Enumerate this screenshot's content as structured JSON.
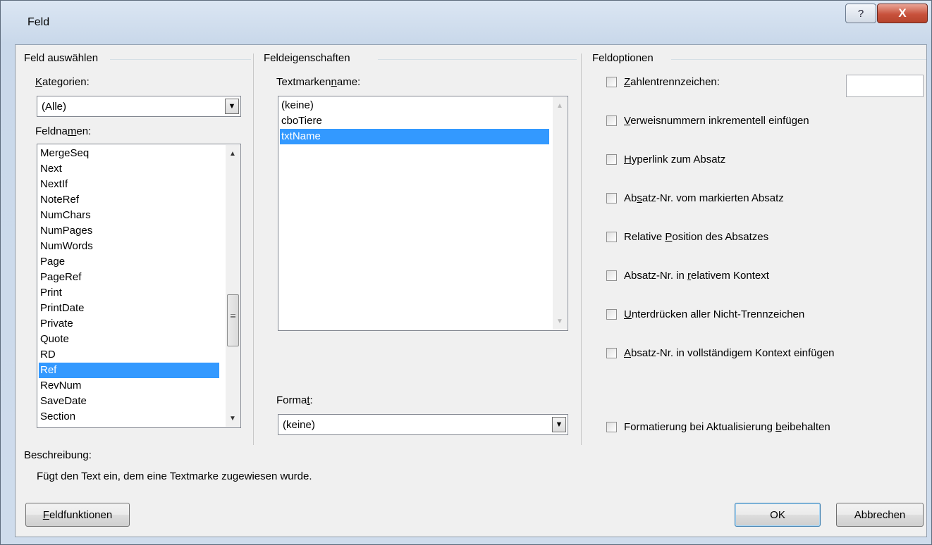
{
  "window": {
    "title": "Feld",
    "help_glyph": "?",
    "close_glyph": "X"
  },
  "select_field": {
    "group_title": "Feld auswählen",
    "categories_label_pre": "",
    "categories_label_mn": "K",
    "categories_label_post": "ategorien:",
    "categories_value": "(Alle)",
    "fieldnames_label_pre": "Feldna",
    "fieldnames_label_mn": "m",
    "fieldnames_label_post": "en:",
    "fieldnames": [
      "MergeSeq",
      "Next",
      "NextIf",
      "NoteRef",
      "NumChars",
      "NumPages",
      "NumWords",
      "Page",
      "PageRef",
      "Print",
      "PrintDate",
      "Private",
      "Quote",
      "RD",
      "Ref",
      "RevNum",
      "SaveDate",
      "Section"
    ],
    "selected_fieldname": "Ref"
  },
  "properties": {
    "group_title": "Feldeigenschaften",
    "bookmark_label_pre": "Textmarken",
    "bookmark_label_mn": "n",
    "bookmark_label_post": "ame:",
    "bookmarks": [
      "(keine)",
      "cboTiere",
      "txtName"
    ],
    "selected_bookmark": "txtName",
    "format_label_pre": "Forma",
    "format_label_mn": "t",
    "format_label_post": ":",
    "format_value": "(keine)"
  },
  "options": {
    "group_title": "Feldoptionen",
    "items": [
      {
        "pre": "",
        "mn": "Z",
        "post": "ahlentrennzeichen:",
        "checked": false
      },
      {
        "pre": "",
        "mn": "V",
        "post": "erweisnummern inkrementell einfügen",
        "checked": false
      },
      {
        "pre": "",
        "mn": "H",
        "post": "yperlink zum Absatz",
        "checked": false
      },
      {
        "pre": "Ab",
        "mn": "s",
        "post": "atz-Nr. vom markierten Absatz",
        "checked": false
      },
      {
        "pre": "Relative ",
        "mn": "P",
        "post": "osition des Absatzes",
        "checked": false
      },
      {
        "pre": "Absatz-Nr. in ",
        "mn": "r",
        "post": "elativem Kontext",
        "checked": false
      },
      {
        "pre": "",
        "mn": "U",
        "post": "nterdrücken aller Nicht-Trennzeichen",
        "checked": false
      },
      {
        "pre": "",
        "mn": "A",
        "post": "bsatz-Nr. in vollständigem Kontext einfügen",
        "checked": false
      },
      {
        "pre": "Formatierung bei Aktualisierung ",
        "mn": "b",
        "post": "eibehalten",
        "checked": false
      }
    ],
    "separator_value": ""
  },
  "description": {
    "label": "Beschreibung:",
    "text": "Fügt den Text ein, dem eine Textmarke zugewiesen wurde."
  },
  "buttons": {
    "field_codes_mn": "F",
    "field_codes_post": "eldfunktionen",
    "ok": "OK",
    "cancel": "Abbrechen"
  }
}
